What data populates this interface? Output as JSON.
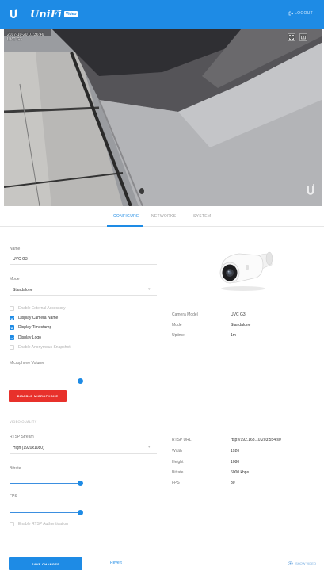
{
  "header": {
    "logo_icon": "ubiquiti-u-icon",
    "brand": "UniFi",
    "brand_badge": "Video",
    "logout_label": "Logout",
    "logout_icon": "logout-icon",
    "bar_color": "#1e8be5"
  },
  "feed": {
    "timestamp": "2017-10-20 01:36:46",
    "camera_name": "UVC G3",
    "buttons": [
      "fullscreen-icon",
      "snapshot-icon"
    ],
    "watermark_icon": "ubiquiti-u-icon"
  },
  "tabs": [
    {
      "label": "Configure",
      "active": true
    },
    {
      "label": "Networks",
      "active": false
    },
    {
      "label": "System",
      "active": false
    }
  ],
  "configure": {
    "name_label": "Name",
    "name_value": "UVC G3",
    "mode_label": "Mode",
    "mode_value": "Standalone",
    "checkboxes": [
      {
        "label": "Enable External Accessory",
        "checked": false
      },
      {
        "label": "Display Camera Name",
        "checked": true
      },
      {
        "label": "Display Timestamp",
        "checked": true
      },
      {
        "label": "Display Logo",
        "checked": true
      },
      {
        "label": "Enable Anonymous Snapshot",
        "checked": false
      }
    ],
    "microphone_label": "Microphone Volume",
    "microphone_level": 1.0,
    "disable_mic_button": "Disable Microphone"
  },
  "camera_info": {
    "image_icon": "camera-icon",
    "rows": [
      {
        "label": "Camera Model",
        "value": "UVC G3"
      },
      {
        "label": "Mode",
        "value": "Standalone"
      },
      {
        "label": "Uptime",
        "value": "1m"
      }
    ]
  },
  "video_quality": {
    "section_title": "Video Quality",
    "rtsp_stream_label": "RTSP Stream",
    "rtsp_stream_value": "High (1920x1080)",
    "bitrate_label": "Bitrate",
    "bitrate_level": 1.0,
    "fps_label": "FPS",
    "fps_level": 1.0,
    "enable_rtsp_auth": "Enable RTSP Authentication",
    "info_rows": [
      {
        "label": "RTSP URL",
        "value": "rtsp://192.168.10.203:554/s0"
      },
      {
        "label": "Width",
        "value": "1920"
      },
      {
        "label": "Height",
        "value": "1080"
      },
      {
        "label": "Bitrate",
        "value": "6000 kbps"
      },
      {
        "label": "FPS",
        "value": "30"
      }
    ]
  },
  "footer": {
    "save_button": "Save Changes",
    "reset_link": "Revert",
    "show_video": "Show Video",
    "show_video_icon": "eye-icon"
  }
}
